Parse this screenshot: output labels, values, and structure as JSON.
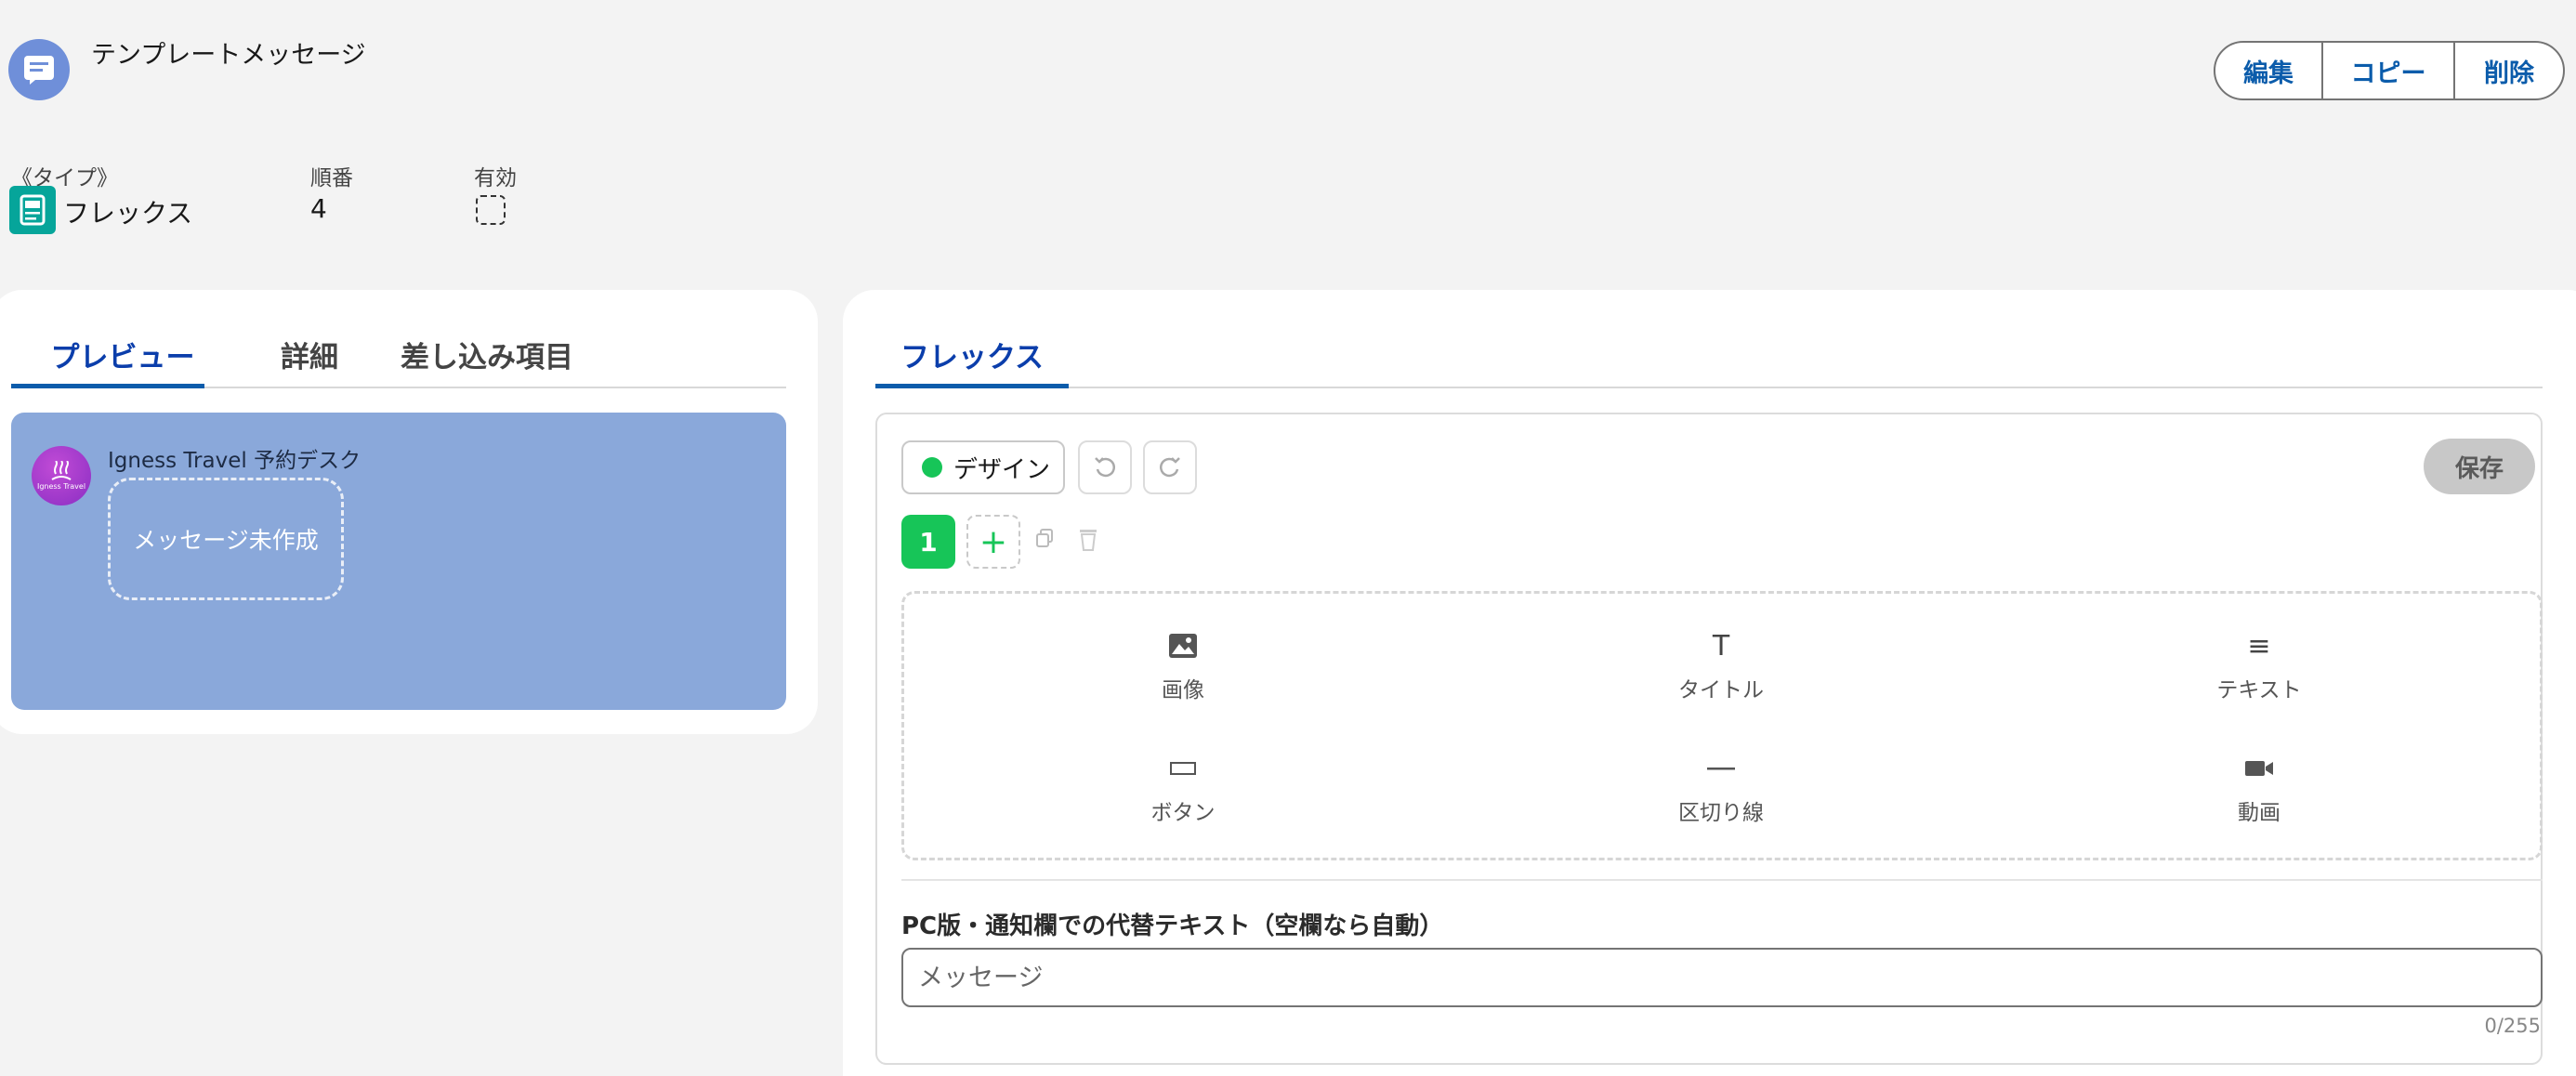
{
  "header": {
    "title": "テンプレートメッセージ",
    "actions": {
      "edit": "編集",
      "copy": "コピー",
      "delete": "削除"
    }
  },
  "fields": {
    "type_label": "《タイプ》",
    "type_value": "フレックス",
    "order_label": "順番",
    "order_value": "4",
    "active_label": "有効",
    "active_checked": false
  },
  "left_tabs": [
    "プレビュー",
    "詳細",
    "差し込み項目"
  ],
  "left_active_tab": "プレビュー",
  "preview": {
    "sender": "Igness Travel 予約デスク",
    "avatar_text": "Igness Travel",
    "bubble_placeholder": "メッセージ未作成",
    "background_color": "#8aa8da"
  },
  "right_tabs": [
    "フレックス"
  ],
  "editor": {
    "design_label": "デザイン",
    "save_label": "保存",
    "page_number": "1",
    "palette": [
      {
        "label": "画像",
        "icon": "image-icon"
      },
      {
        "label": "タイトル",
        "icon": "title-T-icon"
      },
      {
        "label": "テキスト",
        "icon": "text-lines-icon"
      },
      {
        "label": "ボタン",
        "icon": "button-rect-icon"
      },
      {
        "label": "区切り線",
        "icon": "divider-line-icon"
      },
      {
        "label": "動画",
        "icon": "video-camera-icon"
      }
    ],
    "alt_text_label": "PC版・通知欄での代替テキスト（空欄なら自動）",
    "alt_text_placeholder": "メッセージ",
    "alt_text_value": "",
    "alt_text_counter": "0/255"
  },
  "colors": {
    "accent_blue": "#0b5cab",
    "green": "#17c558",
    "teal": "#06a59a",
    "header_icon": "#6f8fd9"
  }
}
